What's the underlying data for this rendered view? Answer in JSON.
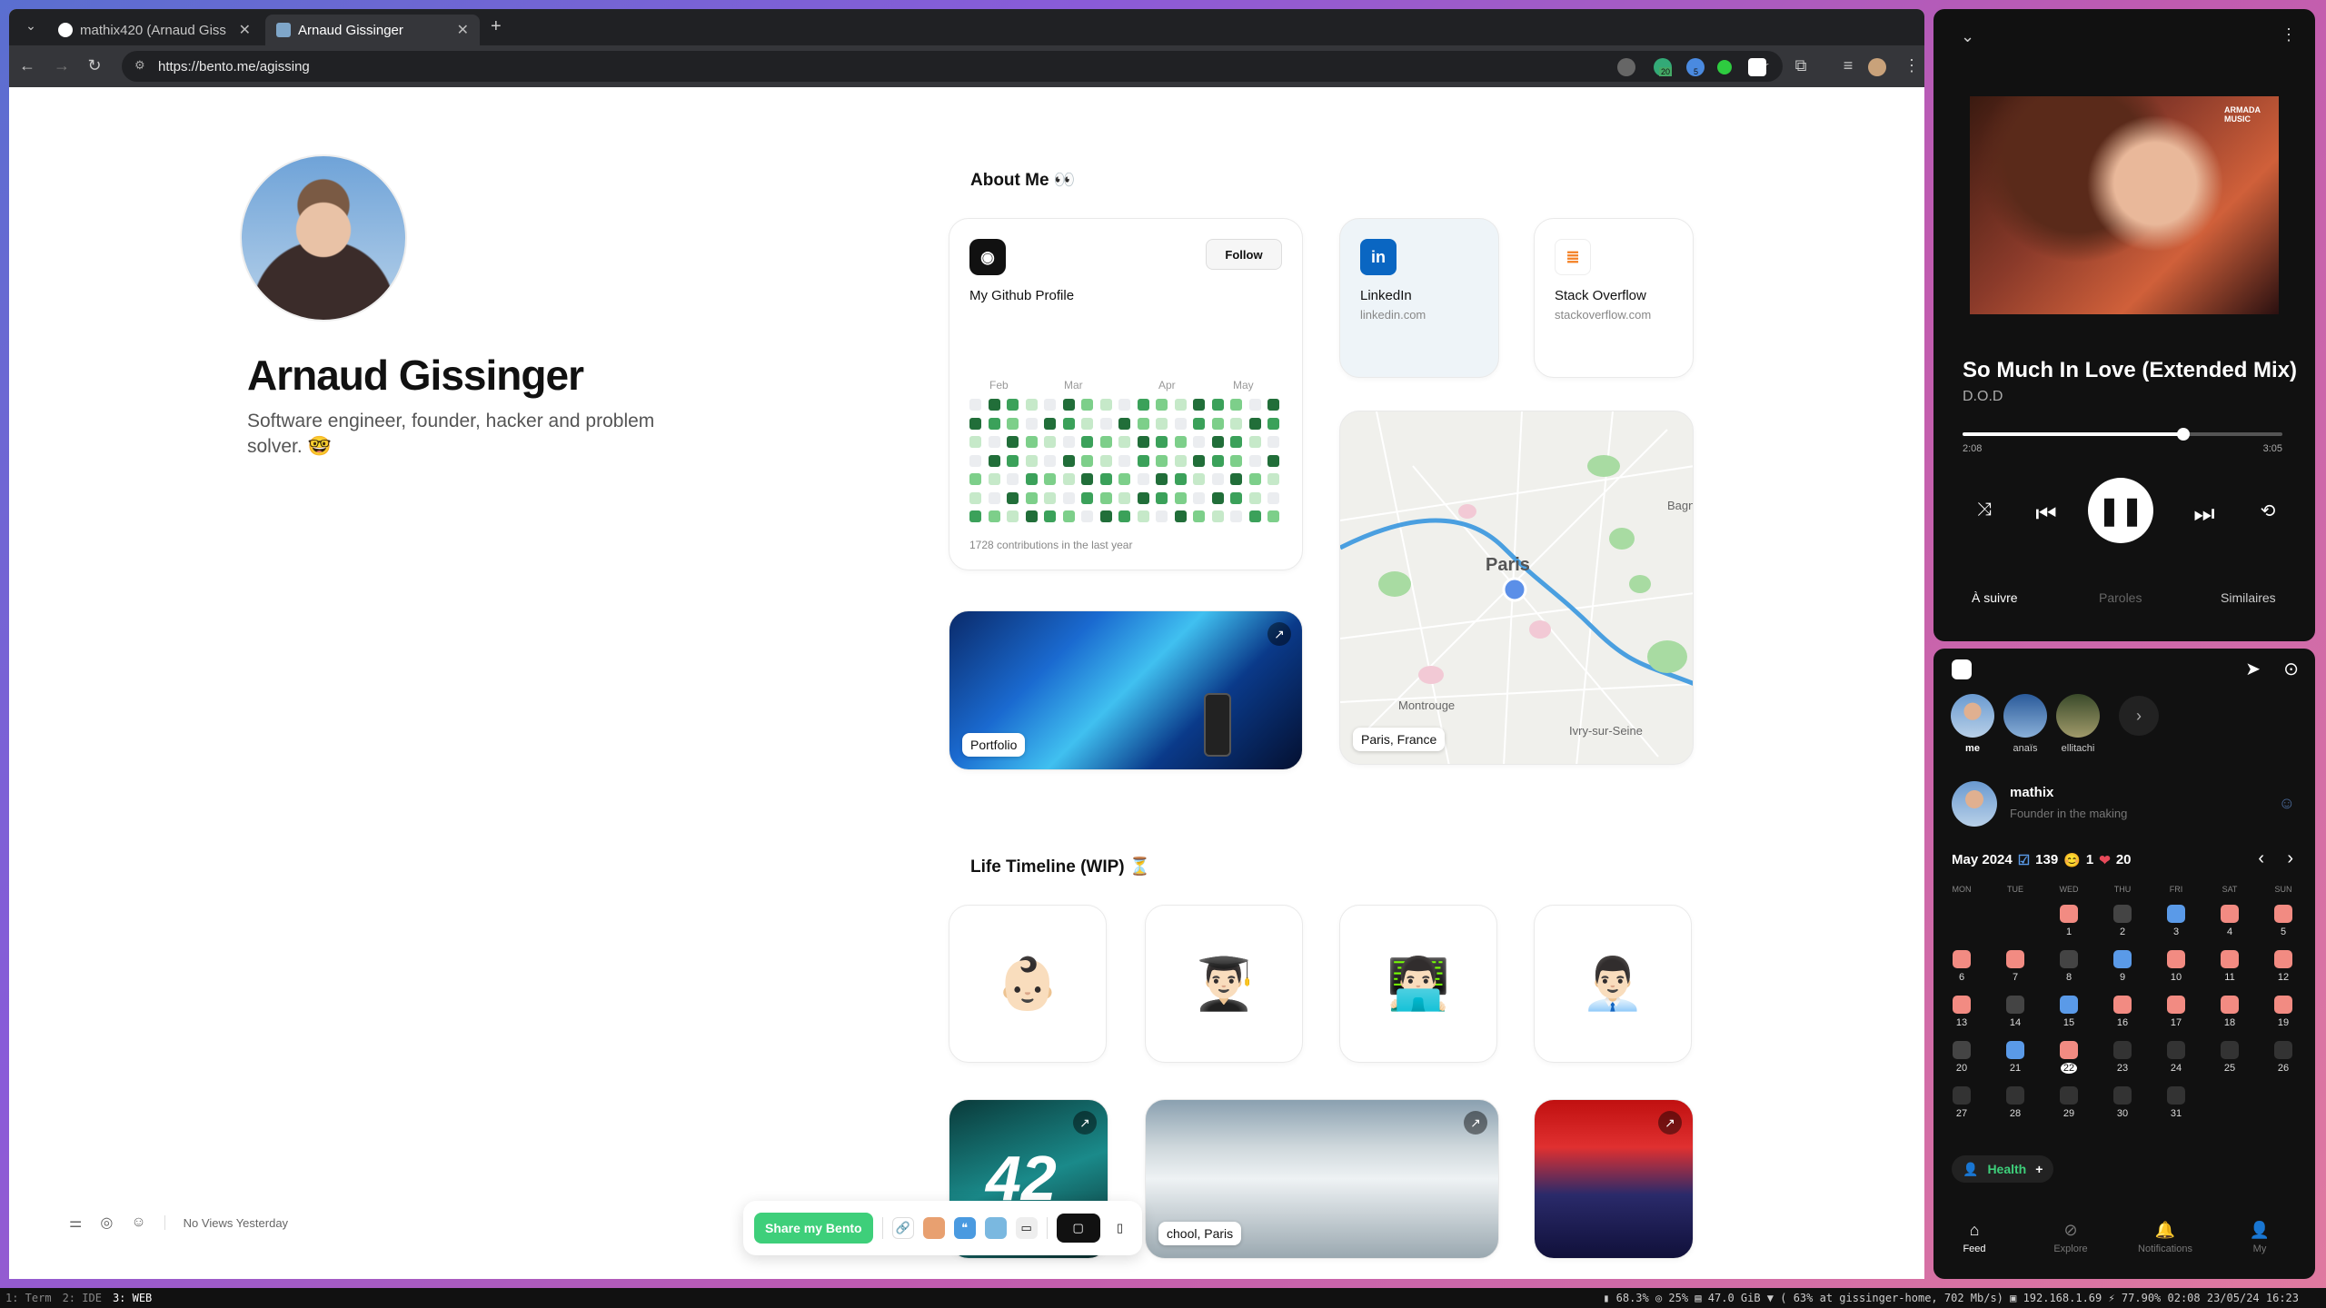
{
  "browser": {
    "tabs": [
      {
        "title": "mathix420 (Arnaud Giss",
        "active": false
      },
      {
        "title": "Arnaud Gissinger",
        "active": true
      }
    ],
    "new_tab_label": "+",
    "url": "https://bento.me/agissing",
    "extension_badges": {
      "ext1": "20",
      "ext2": "5"
    }
  },
  "profile": {
    "name": "Arnaud Gissinger",
    "bio": "Software engineer, founder, hacker and problem solver. 🤓"
  },
  "about": {
    "title": "About Me 👀",
    "github": {
      "title": "My Github Profile",
      "follow_label": "Follow",
      "months": [
        "Feb",
        "Mar",
        "Apr",
        "May"
      ],
      "contributions": "1728 contributions in the last year"
    },
    "linkedin": {
      "title": "LinkedIn",
      "sub": "linkedin.com"
    },
    "stackoverflow": {
      "title": "Stack Overflow",
      "sub": "stackoverflow.com"
    },
    "portfolio_label": "Portfolio",
    "map": {
      "label": "Paris, France",
      "city": "Paris",
      "places": [
        "Montrouge",
        "Ivry-sur-Seine",
        "Bagn"
      ]
    }
  },
  "timeline": {
    "title": "Life Timeline (WIP) ⏳",
    "emojis": [
      "👶🏻",
      "👨🏻‍🎓",
      "👨🏻‍💻",
      "👨🏻‍💼"
    ],
    "school_label": "chool, Paris",
    "logo_42": "42"
  },
  "bottom": {
    "views": "No Views Yesterday",
    "share_label": "Share my Bento"
  },
  "music": {
    "song": "So Much In Love (Extended Mix)",
    "artist": "D.O.D",
    "elapsed": "2:08",
    "total": "3:05",
    "progress": 0.69,
    "cover_brand": "ARMADA MUSIC",
    "tabs": [
      "À suivre",
      "Paroles",
      "Similaires"
    ]
  },
  "social": {
    "stories": [
      {
        "name": "me"
      },
      {
        "name": "anaïs"
      },
      {
        "name": "ellitachi"
      }
    ],
    "user": {
      "name": "mathix",
      "status": "Founder in the making"
    },
    "calendar": {
      "month": "May 2024",
      "stats": [
        {
          "icon": "☑",
          "value": "139"
        },
        {
          "icon": "😊",
          "value": "1"
        },
        {
          "icon": "❤",
          "value": "20"
        }
      ],
      "weekdays": [
        "MON",
        "TUE",
        "WED",
        "THU",
        "FRI",
        "SAT",
        "SUN"
      ],
      "today": "22"
    },
    "health_label": "Health",
    "nav": [
      "Feed",
      "Explore",
      "Notifications",
      "My"
    ]
  },
  "statusbar": {
    "workspaces": [
      "1: Term",
      "2: IDE",
      "3: WEB"
    ],
    "right": "▮ 68.3%  ◎ 25%  ▤ 47.0 GiB  ▼ ( 63% at gissinger-home, 702 Mb/s) ▣ 192.168.1.69  ⚡ 77.90% 02:08  23/05/24 16:23"
  },
  "colors": {
    "accent_green": "#3ecf7a",
    "github_dark": "#216e39",
    "linkedin": "#0a66c2"
  }
}
